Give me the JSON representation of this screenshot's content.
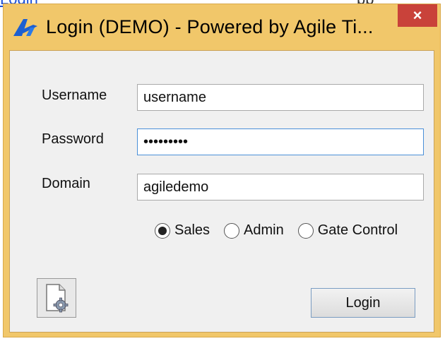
{
  "background": {
    "link_text": "Login",
    "trailing_text": "pp"
  },
  "window": {
    "title": "Login (DEMO) - Powered by Agile Ti...",
    "close_symbol": "×",
    "logo_icon": "agile-logo-icon",
    "colors": {
      "frame": "#f1c76a",
      "close": "#c9423a",
      "client": "#f0f0f0",
      "focus_border": "#4a8fd8"
    }
  },
  "form": {
    "username": {
      "label": "Username",
      "value": "username"
    },
    "password": {
      "label": "Password",
      "value": "•••••••••"
    },
    "domain": {
      "label": "Domain",
      "value": "agiledemo"
    },
    "mode_options": [
      {
        "label": "Sales",
        "selected": true
      },
      {
        "label": "Admin",
        "selected": false
      },
      {
        "label": "Gate Control",
        "selected": false
      }
    ],
    "settings_icon": "settings-document-gear-icon",
    "login_label": "Login"
  }
}
